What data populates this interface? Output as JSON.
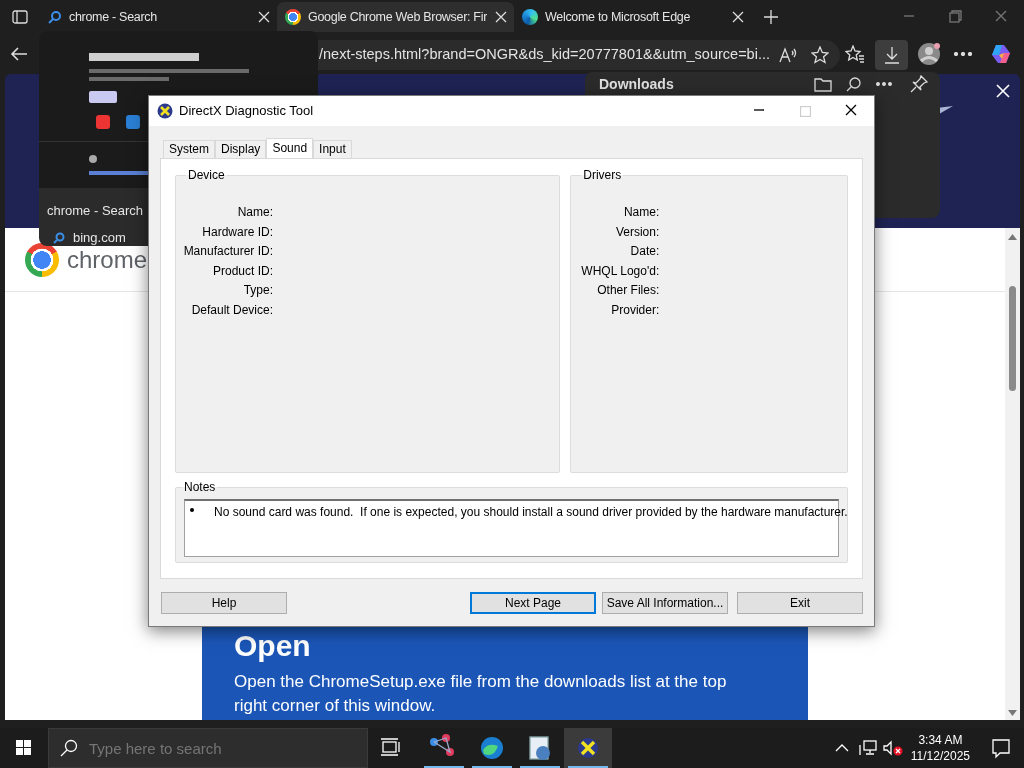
{
  "browser": {
    "tabs": [
      {
        "kind": "search",
        "label": "chrome - Search",
        "selected": false
      },
      {
        "kind": "chrome",
        "label": "Google Chrome Web Browser: Fir",
        "selected": true
      },
      {
        "kind": "edge",
        "label": "Welcome to Microsoft Edge",
        "selected": false
      }
    ],
    "address": "/next-steps.html?brand=ONGR&ds_kid=20777801&&utm_source=bi...",
    "page": {
      "logo_text": "chrome",
      "card_heading": "Open",
      "card_text": "Open the ChromeSetup.exe file from the downloads list at the top right corner of this window."
    }
  },
  "tab_preview": {
    "title": "chrome - Search",
    "site": "bing.com"
  },
  "downloads": {
    "title": "Downloads"
  },
  "dialog": {
    "title": "DirectX Diagnostic Tool",
    "tabs": [
      {
        "label": "System",
        "selected": false
      },
      {
        "label": "Display",
        "selected": false
      },
      {
        "label": "Sound",
        "selected": true
      },
      {
        "label": "Input",
        "selected": false
      }
    ],
    "device": {
      "title": "Device",
      "fields": [
        "Name:",
        "Hardware ID:",
        "Manufacturer ID:",
        "Product ID:",
        "Type:",
        "Default Device:"
      ]
    },
    "drivers": {
      "title": "Drivers",
      "fields": [
        "Name:",
        "Version:",
        "Date:",
        "WHQL Logo'd:",
        "Other Files:",
        "Provider:"
      ]
    },
    "notes": {
      "title": "Notes",
      "items": [
        "No sound card was found.  If one is expected, you should install a sound driver provided by the hardware manufacturer."
      ]
    },
    "buttons": [
      {
        "label": "Help",
        "focused": false
      },
      {
        "label": "Next Page",
        "focused": true
      },
      {
        "label": "Save All Information...",
        "focused": false
      },
      {
        "label": "Exit",
        "focused": false
      }
    ]
  },
  "taskbar": {
    "search_placeholder": "Type here to search",
    "apps": [
      {
        "kind": "network",
        "selected": false
      },
      {
        "kind": "edge",
        "selected": false
      },
      {
        "kind": "dxdiag",
        "selected": false
      },
      {
        "kind": "directx",
        "selected": true
      }
    ],
    "time": "3:34 AM",
    "date": "11/12/2025"
  }
}
